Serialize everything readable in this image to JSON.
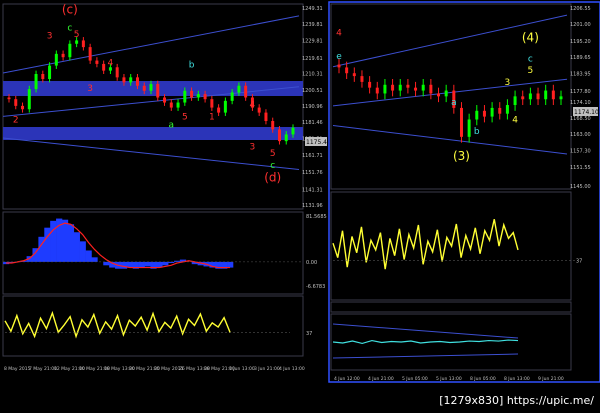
{
  "colors": {
    "background": "#000000",
    "grid": "#2a2a3a",
    "bull": "#00ff00",
    "bear": "#ff2020",
    "zone": "#2b34b8",
    "trendline": "#3c4fd0",
    "histogram": "#1e3cff",
    "signal": "#ff2020",
    "oscillator": "#ffff33",
    "wave_red": "#ff3030",
    "wave_green": "#33ff33",
    "wave_cyan": "#40e0e0",
    "wave_yellow": "#ffff40",
    "axis_text": "#c0c0c0",
    "accent_panel_border": "#3050ff"
  },
  "watermark": "[1279x830] https://upic.me/",
  "chart_data": [
    {
      "type": "line",
      "panel": "left-price",
      "price_ticks": [
        "1249.31",
        "1239.81",
        "1229.81",
        "1219.61",
        "1210.31",
        "1200.51",
        "1190.96",
        "1181.46",
        "1171.51",
        "1161.71",
        "1151.76",
        "1141.31",
        "1131.96"
      ],
      "current_price_label": "1175.40",
      "x_tick_labels": [
        "8 May 2015",
        "7 May 21:00",
        "12 May 21:00",
        "10 May 21:00",
        "18 May 13:00",
        "20 May 21:00",
        "25 May 2015",
        "26 May 13:00",
        "28 May 21:00",
        "1 Jun 13:00",
        "3 Jun 21:00",
        "4 Jun 13:00"
      ],
      "y_range": [
        1131.96,
        1249.31
      ],
      "close": [
        1195,
        1191,
        1189,
        1201,
        1210,
        1207,
        1215,
        1222,
        1220,
        1228,
        1230,
        1226,
        1218,
        1216,
        1212,
        1214,
        1208,
        1205,
        1208,
        1203,
        1200,
        1204,
        1196,
        1193,
        1190,
        1193,
        1200,
        1196,
        1198,
        1195,
        1190,
        1187,
        1194,
        1199,
        1203,
        1196,
        1190,
        1187,
        1182,
        1177,
        1170,
        1174,
        1178
      ],
      "wave_labels": [
        {
          "text": "(c)",
          "color": "wave_red",
          "bar": 9,
          "price": 1246
        },
        {
          "text": "c",
          "color": "wave_green",
          "bar": 9,
          "price": 1236
        },
        {
          "text": "3",
          "color": "wave_red",
          "bar": 6,
          "price": 1231
        },
        {
          "text": "5",
          "color": "wave_red",
          "bar": 10,
          "price": 1232
        },
        {
          "text": "4",
          "color": "wave_red",
          "bar": 15,
          "price": 1215
        },
        {
          "text": "3",
          "color": "wave_red",
          "bar": 12,
          "price": 1200
        },
        {
          "text": "b",
          "color": "wave_cyan",
          "bar": 27,
          "price": 1214
        },
        {
          "text": "a",
          "color": "wave_green",
          "bar": 24,
          "price": 1178
        },
        {
          "text": "5",
          "color": "wave_red",
          "bar": 26,
          "price": 1183
        },
        {
          "text": "1",
          "color": "wave_red",
          "bar": 30,
          "price": 1183
        },
        {
          "text": "4",
          "color": "wave_red",
          "bar": 36,
          "price": 1190
        },
        {
          "text": "2",
          "color": "wave_red",
          "bar": 1,
          "price": 1181
        },
        {
          "text": "3",
          "color": "wave_red",
          "bar": 36,
          "price": 1165
        },
        {
          "text": "5",
          "color": "wave_red",
          "bar": 39,
          "price": 1161
        },
        {
          "text": "c",
          "color": "wave_green",
          "bar": 39,
          "price": 1154
        },
        {
          "text": "(d)",
          "color": "wave_red",
          "bar": 39,
          "price": 1146
        }
      ]
    },
    {
      "type": "line",
      "panel": "right-price",
      "price_ticks": [
        "1206.55",
        "1201.00",
        "1195.20",
        "1189.65",
        "1183.95",
        "1177.80",
        "1174.10",
        "1168.50",
        "1163.00",
        "1157.30",
        "1151.55",
        "1145.00"
      ],
      "current_price_label": "1174.10",
      "x_tick_labels": [
        "4 Jun 12:00",
        "4 Jun 21:00",
        "5 Jun 05:00",
        "5 Jun 13:00",
        "8 Jun 05:00",
        "8 Jun 13:00",
        "9 Jun 21:00"
      ],
      "y_range": [
        1145.0,
        1206.55
      ],
      "close": [
        1186,
        1184,
        1183,
        1181,
        1179,
        1177,
        1180,
        1178,
        1180,
        1179,
        1178,
        1180,
        1177,
        1176,
        1178,
        1172,
        1162,
        1168,
        1171,
        1169,
        1172,
        1170,
        1173,
        1176,
        1175,
        1177,
        1175,
        1178,
        1175,
        1176
      ],
      "wave_labels": [
        {
          "text": "4",
          "color": "wave_red",
          "bar": 0,
          "price": 1197
        },
        {
          "text": "e",
          "color": "wave_cyan",
          "bar": 0,
          "price": 1189
        },
        {
          "text": "(4)",
          "color": "wave_yellow",
          "bar": 25,
          "price": 1195
        },
        {
          "text": "c",
          "color": "wave_cyan",
          "bar": 25,
          "price": 1188
        },
        {
          "text": "5",
          "color": "wave_yellow",
          "bar": 25,
          "price": 1184
        },
        {
          "text": "a",
          "color": "wave_cyan",
          "bar": 15,
          "price": 1173
        },
        {
          "text": "b",
          "color": "wave_cyan",
          "bar": 18,
          "price": 1163
        },
        {
          "text": "(3)",
          "color": "wave_yellow",
          "bar": 16,
          "price": 1154
        },
        {
          "text": "3",
          "color": "wave_yellow",
          "bar": 22,
          "price": 1180
        },
        {
          "text": "4",
          "color": "wave_yellow",
          "bar": 23,
          "price": 1167
        }
      ]
    },
    {
      "type": "area",
      "panel": "left-macd",
      "tick_labels": [
        "81.5685",
        "0.00",
        "-6.6783"
      ],
      "histogram": [
        -2,
        -1,
        0,
        1,
        5,
        12,
        22,
        30,
        36,
        38,
        37,
        33,
        26,
        18,
        10,
        4,
        0,
        -3,
        -5,
        -6,
        -6,
        -5,
        -6,
        -5,
        -4,
        -6,
        -5,
        -3,
        -1,
        1,
        2,
        0,
        -2,
        -3,
        -4,
        -5,
        -6,
        -6,
        -5
      ],
      "signal": [
        -1,
        -1,
        0,
        1,
        3,
        8,
        15,
        22,
        28,
        32,
        34,
        33,
        29,
        24,
        17,
        11,
        6,
        2,
        -1,
        -3,
        -4,
        -5,
        -5,
        -5,
        -5,
        -5,
        -5,
        -4,
        -3,
        -1,
        0,
        1,
        0,
        -1,
        -2,
        -4,
        -5,
        -5,
        -5
      ]
    },
    {
      "type": "line",
      "panel": "left-oscillator",
      "tick_labels": [
        "37"
      ],
      "values": [
        60,
        40,
        70,
        35,
        55,
        30,
        65,
        45,
        75,
        38,
        52,
        68,
        30,
        62,
        48,
        72,
        36,
        58,
        44,
        70,
        33,
        61,
        50,
        67,
        42,
        74,
        39,
        57,
        46,
        69,
        35,
        63,
        51,
        73,
        40,
        56,
        48,
        66,
        38
      ]
    },
    {
      "type": "line",
      "panel": "right-oscillator",
      "tick_labels": [
        "37"
      ],
      "values": [
        55,
        40,
        68,
        30,
        62,
        45,
        72,
        35,
        58,
        48,
        66,
        28,
        60,
        42,
        70,
        38,
        64,
        50,
        74,
        33,
        57,
        46,
        69,
        36,
        61,
        52,
        75,
        40,
        63,
        49,
        71,
        44,
        68,
        58,
        80,
        52,
        74,
        60,
        66,
        48
      ]
    },
    {
      "type": "line",
      "panel": "right-bands",
      "tick_labels": [],
      "values": [
        50,
        48,
        52,
        47,
        53,
        49,
        51,
        50,
        52,
        48,
        50,
        51,
        49,
        50,
        52,
        51,
        53,
        52,
        54,
        53
      ]
    }
  ]
}
